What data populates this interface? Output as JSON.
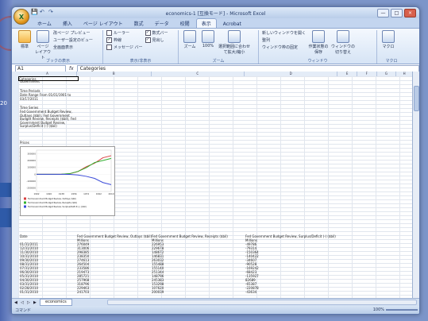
{
  "window": {
    "title": "economics-1 [互換モード] - Microsoft Excel",
    "controls": [
      "—",
      "□",
      "×"
    ],
    "qat": [
      "💾",
      "↶",
      "↷"
    ]
  },
  "ribbon": {
    "tabs": [
      "ホーム",
      "挿入",
      "ページ レイアウト",
      "数式",
      "データ",
      "校閲",
      "表示",
      "Acrobat"
    ],
    "active_tab": "表示",
    "groups": {
      "book_views": {
        "name": "ブックの表示",
        "standard": "標準",
        "page_layout": "ページ レイアウト",
        "items": [
          "改ページ プレビュー",
          "ユーザー設定のビュー",
          "全画面表示"
        ]
      },
      "show_hide": {
        "name": "表示/非表示",
        "items": [
          "ルーラー",
          "枠線",
          "メッセージ バー",
          "数式バー",
          "見出し"
        ]
      },
      "zoom": {
        "name": "ズーム",
        "zoom": "ズーム",
        "hundred": "100%",
        "selection": "選択範囲に合わせて拡大/縮小"
      },
      "window": {
        "name": "ウィンドウ",
        "items": [
          "新しいウィンドウを開く",
          "整列",
          "ウィンドウ枠の固定"
        ],
        "save_ws": "作業状態の保存",
        "switch": "ウィンドウの切り替え"
      },
      "macro": {
        "name": "マクロ",
        "label": "マクロ"
      }
    }
  },
  "formula_bar": {
    "cell": "A1",
    "fx": "fx",
    "value": "Categories"
  },
  "sheet": {
    "col_headers": [
      "A",
      "B",
      "C",
      "D",
      "E",
      "F",
      "G",
      "H"
    ],
    "intro": [
      "Categories",
      "Government",
      "Time Periods",
      "Date Range From 01/01/1901 to 03/17/2011",
      "Time Series",
      "Fed Government Budget Review, Outlays ($bil), Fed Government Budget Review, Receipts ($bil), Fed Government Budget Review, Surplus/Deficit (-) ($bil)",
      "Prices"
    ],
    "chart_legend": [
      "Fed Government Budget Review, Outlays ($bil)",
      "Fed Government Budget Review, Receipts ($bil)",
      "Fed Government Budget Review, Surplus/Deficit (-) ($bil)"
    ],
    "table_headers": [
      "Date",
      "Fed Government Budget Review, Outlays ($bil)",
      "Fed Government Budget Review, Receipts ($bil)",
      "Fed Government Budget Review, Surplus/Deficit (-) ($bil)"
    ],
    "units": "Millions",
    "rows": [
      [
        "01/31/2011",
        "276049",
        "226953",
        "-49786"
      ],
      [
        "12/31/2010",
        "313006",
        "229678",
        "-79314"
      ],
      [
        "11/30/2010",
        "298385",
        "148672",
        "-150364"
      ],
      [
        "10/31/2010",
        "238350",
        "146831",
        "-140422"
      ],
      [
        "09/30/2010",
        "274613",
        "263032",
        "-34607"
      ],
      [
        "08/31/2010",
        "264504",
        "155488",
        "-90528"
      ],
      [
        "07/31/2010",
        "233586",
        "155140",
        "-169242"
      ],
      [
        "06/30/2010",
        "219473",
        "251344",
        "-68423"
      ],
      [
        "05/31/2010",
        "285721",
        "148796",
        "-135927"
      ],
      [
        "04/30/2010",
        "257968",
        "245383",
        "82689"
      ],
      [
        "03/31/2010",
        "318796",
        "153298",
        "-65387"
      ],
      [
        "02/28/2010",
        "229463",
        "107620",
        "-220878"
      ],
      [
        "01/31/2010",
        "241703",
        "200039",
        "-43634"
      ]
    ]
  },
  "chart_data": {
    "type": "line",
    "title": "",
    "xlabel": "",
    "ylabel": "",
    "x_ticks": [
      "1902",
      "1920",
      "1938",
      "1956",
      "1974",
      "1992",
      "2010"
    ],
    "y_ticks": [
      "300000",
      "200000",
      "100000",
      "0",
      "-100000",
      "-200000"
    ],
    "ylim": [
      -250000,
      350000
    ],
    "series": [
      {
        "name": "Fed Government Budget Review, Outlays ($bil)",
        "color": "#d84040",
        "values": [
          0,
          0,
          0,
          1000,
          8000,
          40000,
          110000,
          160000,
          240000,
          270000
        ]
      },
      {
        "name": "Fed Government Budget Review, Receipts ($bil)",
        "color": "#30b030",
        "values": [
          0,
          0,
          0,
          1500,
          9000,
          42000,
          95000,
          170000,
          200000,
          230000
        ]
      },
      {
        "name": "Fed Government Budget Review, Surplus/Deficit (-) ($bil)",
        "color": "#3a4ad8",
        "values": [
          0,
          0,
          0,
          0,
          -2000,
          -10000,
          -30000,
          -60000,
          -120000,
          -150000
        ]
      }
    ]
  },
  "sheet_tab": "economics",
  "status": {
    "left": "コマンド",
    "zoom": "100%"
  }
}
